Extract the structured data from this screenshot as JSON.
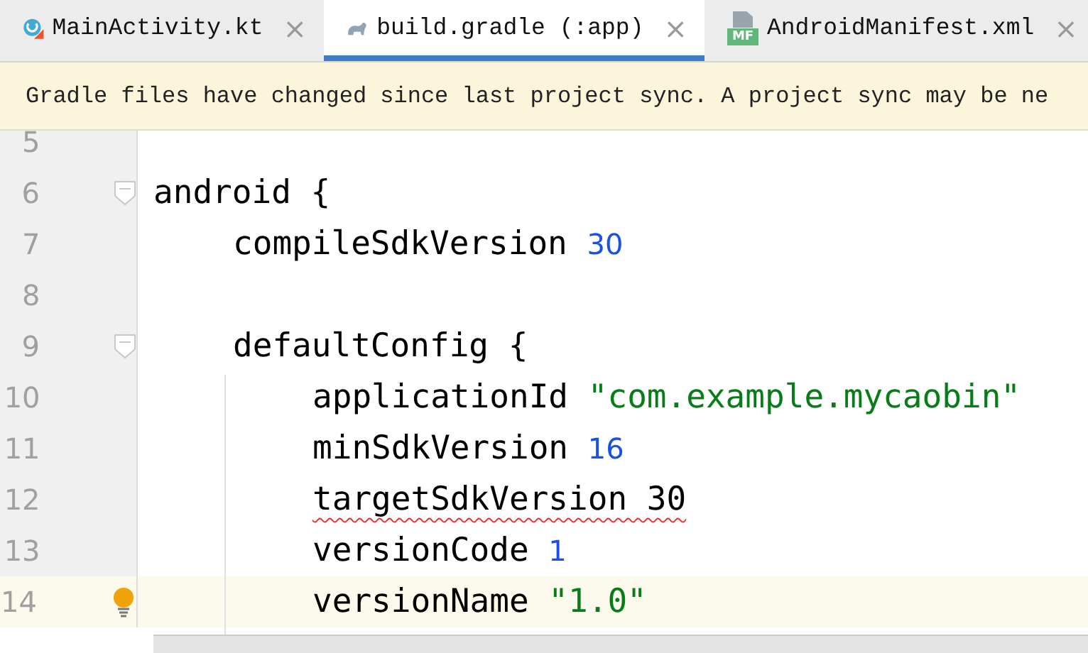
{
  "tabs": [
    {
      "label": "MainActivity.kt",
      "selected": false,
      "close": "×"
    },
    {
      "label": "build.gradle (:app)",
      "selected": true,
      "close": "×"
    },
    {
      "label": "AndroidManifest.xml",
      "icon_text": "MF",
      "selected": false,
      "close": "×"
    }
  ],
  "banner": {
    "text": "Gradle files have changed since last project sync. A project sync may be ne"
  },
  "editor": {
    "lines": [
      {
        "number": "5",
        "fold": false,
        "bulb": false,
        "current": false
      },
      {
        "number": "6",
        "fold": true,
        "bulb": false,
        "current": false,
        "tokens": [
          {
            "kind": "plain",
            "text": "android {"
          }
        ],
        "children": [
          {
            "number": "7",
            "fold": false,
            "bulb": false,
            "current": false,
            "tokens": [
              {
                "kind": "plain",
                "text": "compileSdkVersion "
              },
              {
                "kind": "number",
                "text": "30"
              }
            ]
          },
          {
            "number": "8",
            "fold": false,
            "bulb": false,
            "current": false
          },
          {
            "number": "9",
            "fold": true,
            "bulb": false,
            "current": false,
            "tokens": [
              {
                "kind": "plain",
                "text": "defaultConfig {"
              }
            ],
            "children": [
              {
                "number": "10",
                "fold": false,
                "bulb": false,
                "current": false,
                "tokens": [
                  {
                    "kind": "plain",
                    "text": "applicationId "
                  },
                  {
                    "kind": "string",
                    "text": "\"com.example.mycaobin\""
                  }
                ]
              },
              {
                "number": "11",
                "fold": false,
                "bulb": false,
                "current": false,
                "tokens": [
                  {
                    "kind": "plain",
                    "text": "minSdkVersion "
                  },
                  {
                    "kind": "number",
                    "text": "16"
                  }
                ]
              },
              {
                "number": "12",
                "fold": false,
                "bulb": false,
                "current": false,
                "tokens": [
                  {
                    "kind": "error",
                    "text": "targetSdkVersion 30"
                  }
                ]
              },
              {
                "number": "13",
                "fold": false,
                "bulb": false,
                "current": false,
                "tokens": [
                  {
                    "kind": "plain",
                    "text": "versionCode "
                  },
                  {
                    "kind": "number",
                    "text": "1"
                  }
                ]
              },
              {
                "number": "14",
                "fold": false,
                "bulb": true,
                "current": true,
                "tokens": [
                  {
                    "kind": "plain",
                    "text": "versionName "
                  },
                  {
                    "kind": "string",
                    "text": "\"1.0\""
                  }
                ]
              }
            ]
          }
        ]
      }
    ]
  }
}
